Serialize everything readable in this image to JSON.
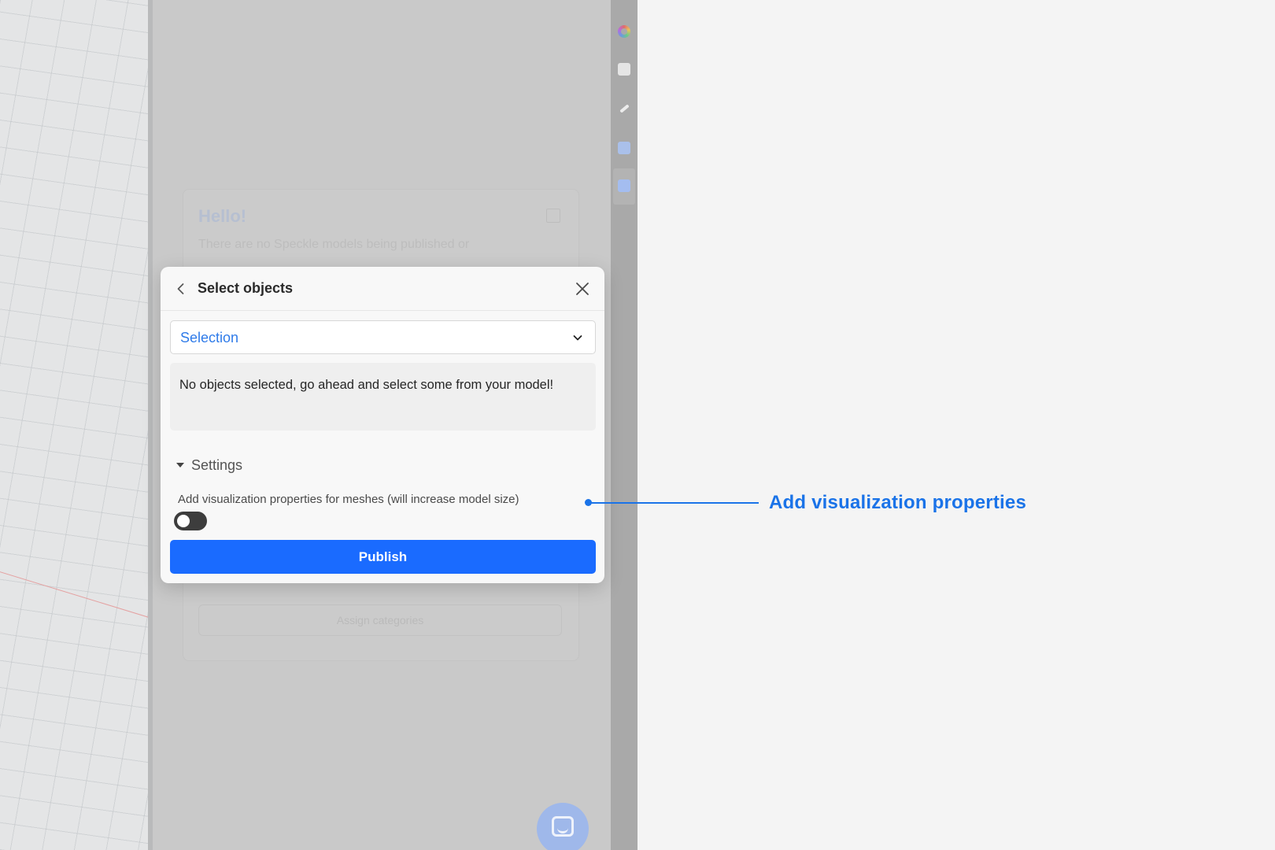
{
  "background_panel": {
    "hello_text": "Hello!",
    "info_text": "There are no Speckle models being published or",
    "assign_button_label": "Assign categories"
  },
  "modal": {
    "title": "Select objects",
    "select": {
      "selected_value": "Selection"
    },
    "notice_text": "No objects selected, go ahead and select some from your model!",
    "settings": {
      "label": "Settings",
      "expanded": true,
      "visualization_toggle": {
        "label": "Add visualization properties for meshes (will increase model size)",
        "enabled": false
      }
    },
    "publish_label": "Publish"
  },
  "callout": {
    "text": "Add visualization properties"
  },
  "colors": {
    "accent_blue": "#1a6bff",
    "callout_blue": "#1a73e8",
    "select_text": "#2f7be9"
  },
  "icons": {
    "back": "chevron-left-icon",
    "close": "close-icon",
    "dropdown": "chevron-down-icon",
    "settings_caret": "caret-down-icon",
    "chat": "chat-icon"
  }
}
